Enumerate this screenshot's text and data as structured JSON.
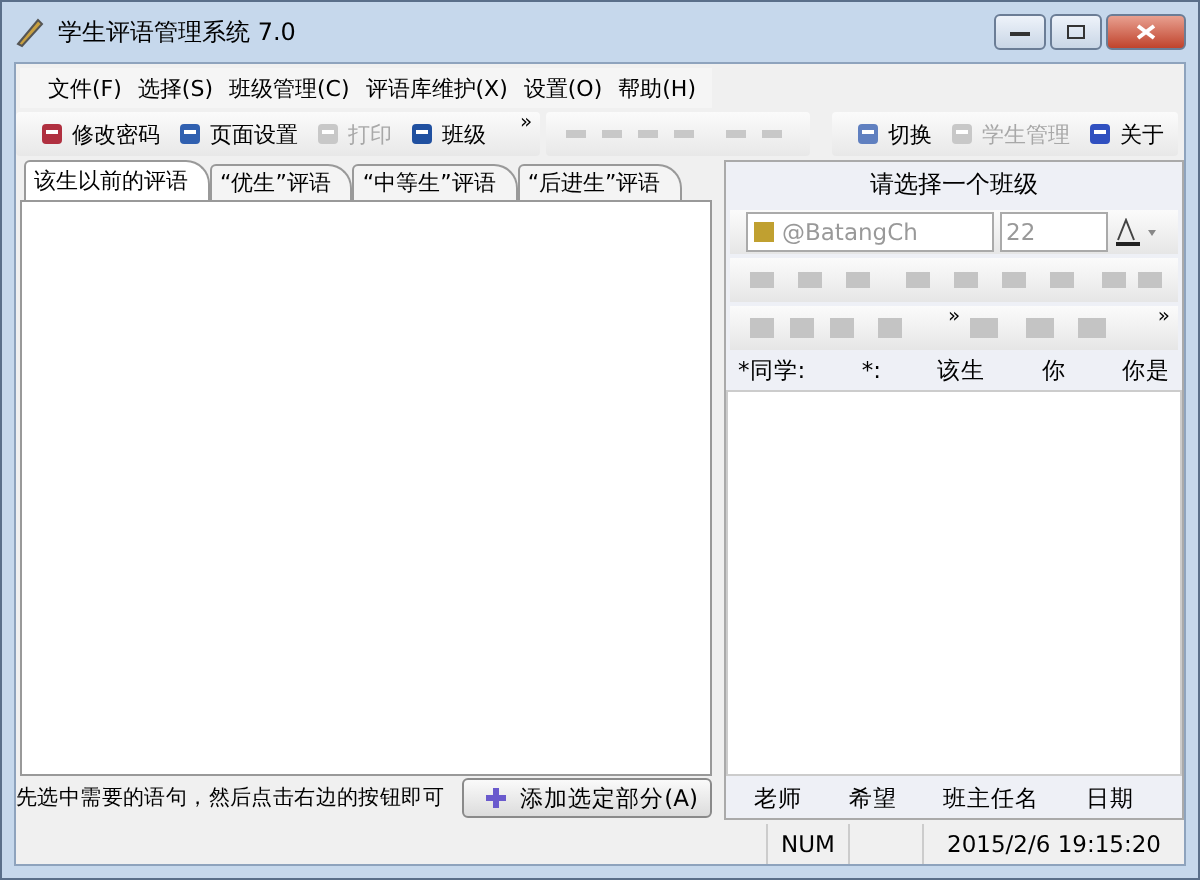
{
  "window": {
    "title": "学生评语管理系统 7.0"
  },
  "menu": [
    "文件(F)",
    "选择(S)",
    "班级管理(C)",
    "评语库维护(X)",
    "设置(O)",
    "帮助(H)"
  ],
  "toolbar": {
    "left": [
      {
        "label": "修改密码",
        "disabled": false
      },
      {
        "label": "页面设置",
        "disabled": false
      },
      {
        "label": "打印",
        "disabled": true
      },
      {
        "label": "班级",
        "disabled": false
      }
    ],
    "chevron": "»",
    "right": [
      {
        "label": "切换",
        "disabled": false
      },
      {
        "label": "学生管理",
        "disabled": true
      },
      {
        "label": "关于",
        "disabled": false
      }
    ]
  },
  "tabs": [
    {
      "label": "该生以前的评语",
      "selected": true
    },
    {
      "label": "“优生”评语",
      "selected": false
    },
    {
      "label": "“中等生”评语",
      "selected": false
    },
    {
      "label": "“后进生”评语",
      "selected": false
    }
  ],
  "hint": "先选中需要的语句，然后点击右边的按钮即可",
  "add_button": "添加选定部分(A)",
  "right_panel": {
    "title": "请选择一个班级",
    "font": "@BatangCh",
    "size": "22",
    "chevrons": [
      "»",
      "»"
    ],
    "header_words": [
      "*同学:",
      "*:",
      "该生",
      "你",
      "你是"
    ],
    "footer_words": [
      "老师",
      "希望",
      "班主任名",
      "日期"
    ]
  },
  "status_bar": [
    "NUM",
    "2015/2/6 19:15:20"
  ]
}
